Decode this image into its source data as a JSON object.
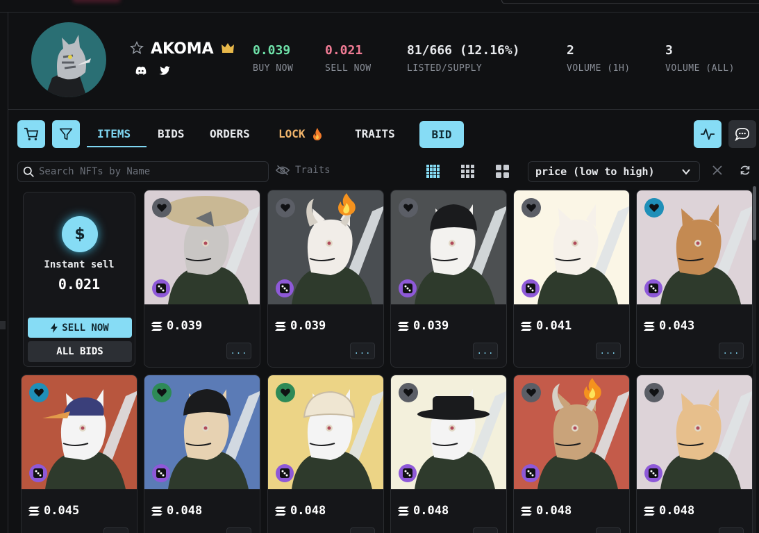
{
  "collection": {
    "name": "AKOMA",
    "stats": [
      {
        "value": "0.039",
        "label": "BUY NOW",
        "color": "#6ee0a8"
      },
      {
        "value": "0.021",
        "label": "SELL NOW",
        "color": "#f07b94"
      },
      {
        "value": "81/666 (12.16%)",
        "label": "LISTED/SUPPLY",
        "color": "#ffffff"
      },
      {
        "value": "2",
        "label": "VOLUME (1H)",
        "color": "#ffffff"
      },
      {
        "value": "3",
        "label": "VOLUME (ALL)",
        "color": "#ffffff"
      }
    ]
  },
  "tabs": {
    "items": "ITEMS",
    "bids": "BIDS",
    "orders": "ORDERS",
    "lock": "LOCK",
    "traits": "TRAITS",
    "bid": "BID"
  },
  "filters": {
    "search_placeholder": "Search NFTs by Name",
    "traits_label": "Traits",
    "sort_value": "price (low to high)"
  },
  "instant_sell": {
    "label": "Instant sell",
    "value": "0.021",
    "sell_now": "SELL NOW",
    "all_bids": "ALL BIDS"
  },
  "more_label": "...",
  "colors": {
    "accent": "#86dcf5",
    "buy": "#6ee0a8",
    "sell": "#f07b94",
    "lock": "#f2b56b",
    "background": "#101113"
  },
  "items": [
    {
      "price": "0.039",
      "bg": "#d9cfd4",
      "heart": "#5b5e66",
      "fire": false
    },
    {
      "price": "0.039",
      "bg": "#4a4e52",
      "heart": "#5b5e66",
      "fire": true
    },
    {
      "price": "0.039",
      "bg": "#4d5052",
      "heart": "#5b5e66",
      "fire": false
    },
    {
      "price": "0.041",
      "bg": "#fbf6e6",
      "heart": "#5b5e66",
      "fire": false
    },
    {
      "price": "0.043",
      "bg": "#ddd3d8",
      "heart": "#1f8fb8",
      "fire": false
    },
    {
      "price": "0.045",
      "bg": "#b8563e",
      "heart": "#1f8fb8",
      "fire": false
    },
    {
      "price": "0.048",
      "bg": "#5b7bb6",
      "heart": "#2e8a57",
      "fire": false
    },
    {
      "price": "0.048",
      "bg": "#ecd486",
      "heart": "#2e8a57",
      "fire": false
    },
    {
      "price": "0.048",
      "bg": "#f3f0dc",
      "heart": "#5b5e66",
      "fire": false
    },
    {
      "price": "0.048",
      "bg": "#c45b4a",
      "heart": "#5b5e66",
      "fire": true
    },
    {
      "price": "0.048",
      "bg": "#ddd3d8",
      "heart": "#5b5e66",
      "fire": false
    }
  ]
}
